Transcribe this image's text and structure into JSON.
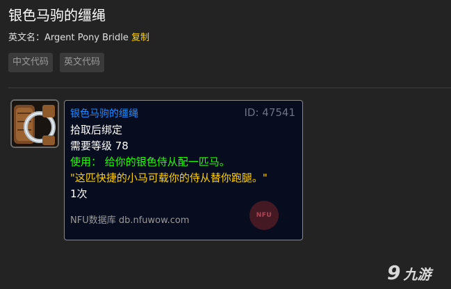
{
  "page": {
    "title": "银色马驹的缰绳",
    "english_name_label": "英文名：",
    "english_name": "Argent Pony Bridle",
    "copy_label": "复制"
  },
  "tabs": [
    {
      "label": "中文代码"
    },
    {
      "label": "英文代码"
    }
  ],
  "tooltip": {
    "name": "银色马驹的缰绳",
    "id_label": "ID: 47541",
    "binding": "拾取后绑定",
    "level_required": "需要等级 78",
    "use_prefix": "使用：",
    "use_text": "给你的银色侍从配一匹马。",
    "flavor": "\"这匹快捷的小马可载你的侍从替你跑腿。\"",
    "charges": "1次",
    "footer": "NFU数据库 db.nfuwow.com",
    "watermark": "NFU"
  },
  "logo": {
    "mark": "9",
    "name": "九游"
  },
  "colors": {
    "background": "#232323",
    "item_name_rare": "#1e8cff",
    "use_green": "#1eff00",
    "flavor_yellow": "#ffd100",
    "copy_link": "#ffd100"
  },
  "icons": {
    "item": "bridle-item-icon"
  }
}
